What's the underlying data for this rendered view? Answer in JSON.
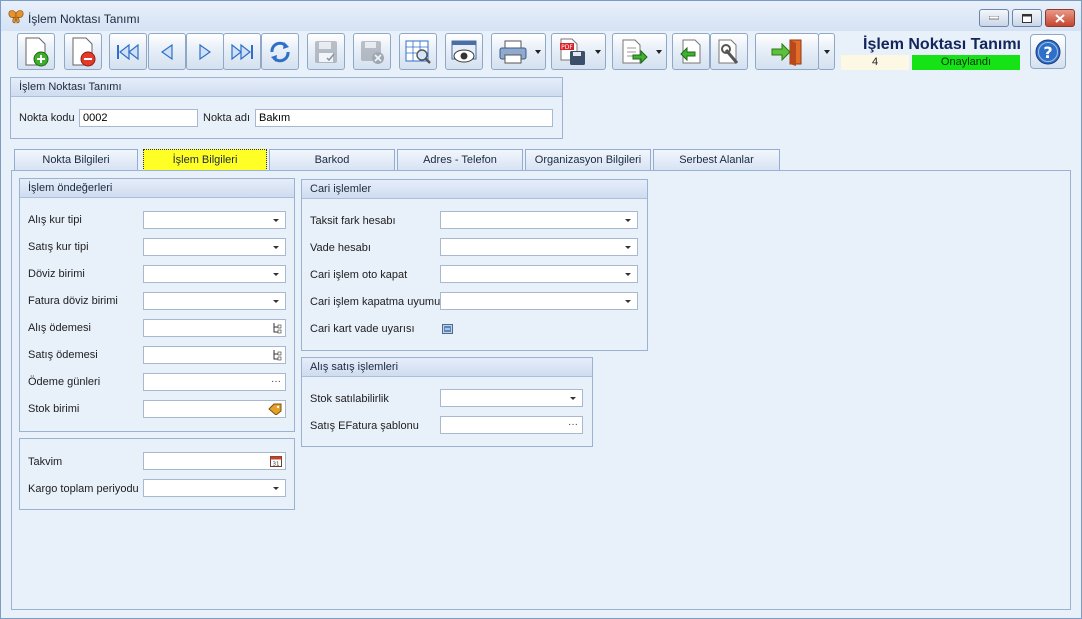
{
  "window": {
    "title": "İşlem Noktası Tanımı"
  },
  "header": {
    "title": "İşlem Noktası Tanımı",
    "record_count": "4",
    "status": "Onaylandı"
  },
  "top_group": {
    "title": "İşlem Noktası Tanımı",
    "code_label": "Nokta kodu",
    "code_value": "0002",
    "name_label": "Nokta adı",
    "name_value": "Bakım"
  },
  "tabs": [
    {
      "label": "Nokta Bilgileri"
    },
    {
      "label": "İşlem Bilgileri"
    },
    {
      "label": "Barkod"
    },
    {
      "label": "Adres - Telefon"
    },
    {
      "label": "Organizasyon Bilgileri"
    },
    {
      "label": "Serbest Alanlar"
    }
  ],
  "defaults_group": {
    "title": "İşlem öndeğerleri",
    "rows": [
      {
        "label": "Alış kur tipi",
        "value": ""
      },
      {
        "label": "Satış kur tipi",
        "value": ""
      },
      {
        "label": "Döviz birimi",
        "value": ""
      },
      {
        "label": "Fatura döviz birimi",
        "value": ""
      },
      {
        "label": "Alış ödemesi",
        "value": ""
      },
      {
        "label": "Satış ödemesi",
        "value": ""
      },
      {
        "label": "Ödeme günleri",
        "value": "",
        "glyph": "···"
      },
      {
        "label": "Stok birimi",
        "value": ""
      }
    ]
  },
  "calendar_group": {
    "rows": [
      {
        "label": "Takvim",
        "value": ""
      },
      {
        "label": "Kargo toplam periyodu",
        "value": ""
      }
    ]
  },
  "cari_group": {
    "title": "Cari işlemler",
    "rows": [
      {
        "label": "Taksit fark hesabı",
        "value": ""
      },
      {
        "label": "Vade hesabı",
        "value": ""
      },
      {
        "label": "Cari işlem oto kapat",
        "value": ""
      },
      {
        "label": "Cari işlem kapatma uyumu",
        "value": ""
      },
      {
        "label": "Cari kart vade uyarısı"
      }
    ]
  },
  "sales_group": {
    "title": "Alış satış işlemleri",
    "rows": [
      {
        "label": "Stok satılabilirlik",
        "value": ""
      },
      {
        "label": "Satış EFatura şablonu",
        "value": "",
        "glyph": "···"
      }
    ]
  },
  "colors": {
    "active_tab": "#ffff26",
    "status_green": "#16e316",
    "title_navy": "#13265c"
  }
}
